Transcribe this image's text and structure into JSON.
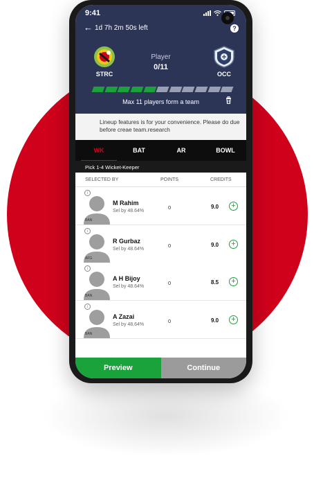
{
  "status": {
    "time": "9:41"
  },
  "header": {
    "countdown": "1d 7h 2m 50s left",
    "help": "?",
    "team_left": {
      "code": "STRC"
    },
    "team_right": {
      "code": "OCC"
    },
    "player_label": "Player",
    "player_count": "0/11",
    "progress": {
      "filled": 5,
      "total": 11
    },
    "max_text": "Max 11 players form a team"
  },
  "info": {
    "text": "Lineup features is for your convenience. Please do due before creae team.research"
  },
  "tabs": [
    {
      "label": "WK",
      "active": true
    },
    {
      "label": "BAT",
      "active": false
    },
    {
      "label": "AR",
      "active": false
    },
    {
      "label": "BOWL",
      "active": false
    }
  ],
  "pick_text": "Pick 1-4 Wicket-Keeper",
  "columns": {
    "selected_by": "SELECTED BY",
    "points": "POINTS",
    "credits": "CREDITS"
  },
  "players": [
    {
      "name": "M Rahim",
      "sel": "Sel by 48.64%",
      "points": "0",
      "credits": "9.0",
      "team": "BAN"
    },
    {
      "name": "R Gurbaz",
      "sel": "Sel by 48.64%",
      "points": "0",
      "credits": "9.0",
      "team": "AFG"
    },
    {
      "name": "A H Bijoy",
      "sel": "Sel by 48.64%",
      "points": "0",
      "credits": "8.5",
      "team": "BAN"
    },
    {
      "name": "A Zazai",
      "sel": "Sel by 48.64%",
      "points": "0",
      "credits": "9.0",
      "team": "BAN"
    }
  ],
  "buttons": {
    "preview": "Preview",
    "continue": "Continue"
  },
  "colors": {
    "accent_red": "#d0021b",
    "header_navy": "#2d3557",
    "green": "#1aa33a",
    "grey_button": "#9b9b9b"
  }
}
